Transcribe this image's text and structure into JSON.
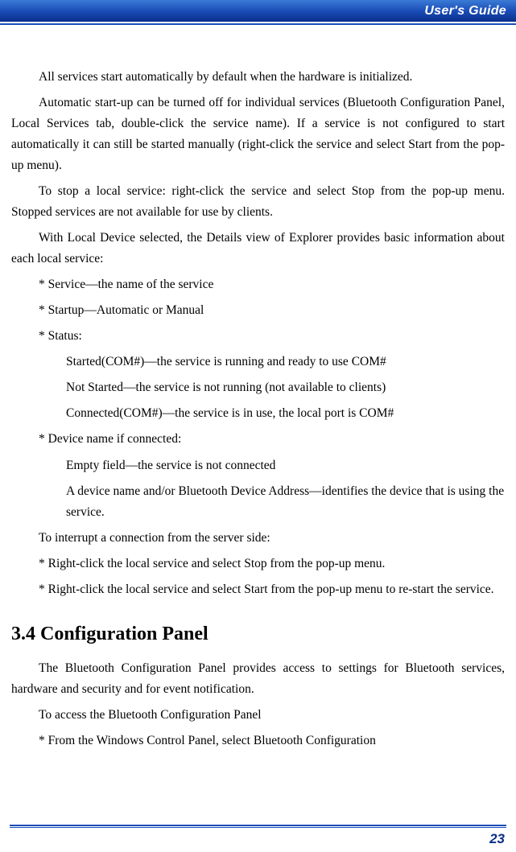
{
  "header": {
    "title": "User's Guide"
  },
  "body": {
    "p1": "All services start automatically by default when the hardware is initialized.",
    "p2": "Automatic start-up can be turned off for individual services (Bluetooth Configuration Panel, Local Services tab, double-click the service name). If a service is not configured to start automatically it can still be started manually (right-click the service and select Start from the pop-up menu).",
    "p3": "To stop a local service: right-click the service and select Stop from the pop-up menu. Stopped services are not available for use by clients.",
    "p4": "With Local Device selected, the Details view of Explorer provides basic information about each local service:",
    "b1": "* Service—the name of the service",
    "b2": "* Startup—Automatic or Manual",
    "b3": "* Status:",
    "s1": "Started(COM#)—the service is running and ready to use COM#",
    "s2": "Not Started—the service is not running (not available to clients)",
    "s3": "Connected(COM#)—the service is in use, the local port is COM#",
    "b4": "* Device name if connected:",
    "s4": "Empty field—the service is not connected",
    "s5": "A device name and/or Bluetooth Device Address—identifies the device that is using the service.",
    "p5": "To interrupt a connection from the server side:",
    "b5": "* Right-click the local service and select Stop from the pop-up menu.",
    "b6": "* Right-click the local service and select Start from the pop-up menu to re-start the service."
  },
  "section": {
    "heading": "3.4 Configuration Panel",
    "p1": "The Bluetooth Configuration Panel provides access to settings for Bluetooth services, hardware and security and for event notification.",
    "p2": "To access the Bluetooth Configuration Panel",
    "b1": "* From the Windows Control Panel, select Bluetooth Configuration"
  },
  "footer": {
    "page": "23"
  }
}
